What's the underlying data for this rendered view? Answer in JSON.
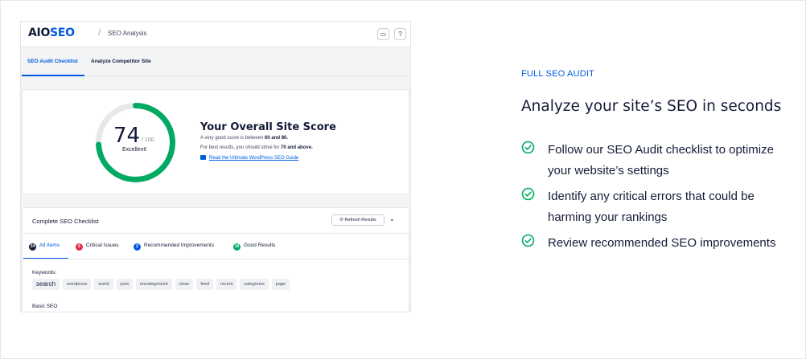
{
  "app": {
    "logo": {
      "prefix": "AIO",
      "suffix": "SEO"
    },
    "separator": "/",
    "page_title": "SEO Analysis",
    "toolbar_icons": [
      "inbox-icon",
      "help-icon"
    ],
    "tabs": [
      {
        "label": "SEO Audit Checklist",
        "active": true
      },
      {
        "label": "Analyze Competitor Site",
        "active": false
      }
    ],
    "score": {
      "value": "74",
      "max": "/ 100",
      "fraction": 0.74,
      "label": "Excellent!",
      "title": "Your Overall Site Score",
      "line1_pre": "A very good score is between ",
      "line1_bold": "60 and 80.",
      "line2_pre": "For best results, you should strive for ",
      "line2_bold": "70 and above.",
      "guide_link": "Read the Ultimate WordPress SEO Guide"
    },
    "checklist": {
      "title": "Complete SEO Checklist",
      "refresh_label": "Refresh Results",
      "filters": [
        {
          "count": "24",
          "label": "All Items",
          "color": "#141b38",
          "active": true
        },
        {
          "count": "6",
          "label": "Critical Issues",
          "color": "#df2a4a",
          "active": false
        },
        {
          "count": "2",
          "label": "Recommended Improvements",
          "color": "#005ae0",
          "active": false
        },
        {
          "count": "16",
          "label": "Good Results",
          "color": "#00aa63",
          "active": false
        }
      ],
      "keywords_label": "Keywords:",
      "keywords": [
        "search",
        "wordpress",
        "world",
        "post",
        "uncategorized",
        "close",
        "feed",
        "recent",
        "categories",
        "page"
      ],
      "section_label": "Basic SEO"
    }
  },
  "marketing": {
    "eyebrow": "FULL SEO AUDIT",
    "headline": "Analyze your site’s SEO in seconds",
    "bullets": [
      "Follow our SEO Audit checklist to optimize your website’s settings",
      "Identify any critical errors that could be harming your rankings",
      "Review recommended SEO improvements"
    ]
  },
  "colors": {
    "accent": "#005ae0",
    "success": "#00aa63",
    "danger": "#df2a4a",
    "text": "#141b38",
    "gauge_track": "#e8e8eb"
  }
}
